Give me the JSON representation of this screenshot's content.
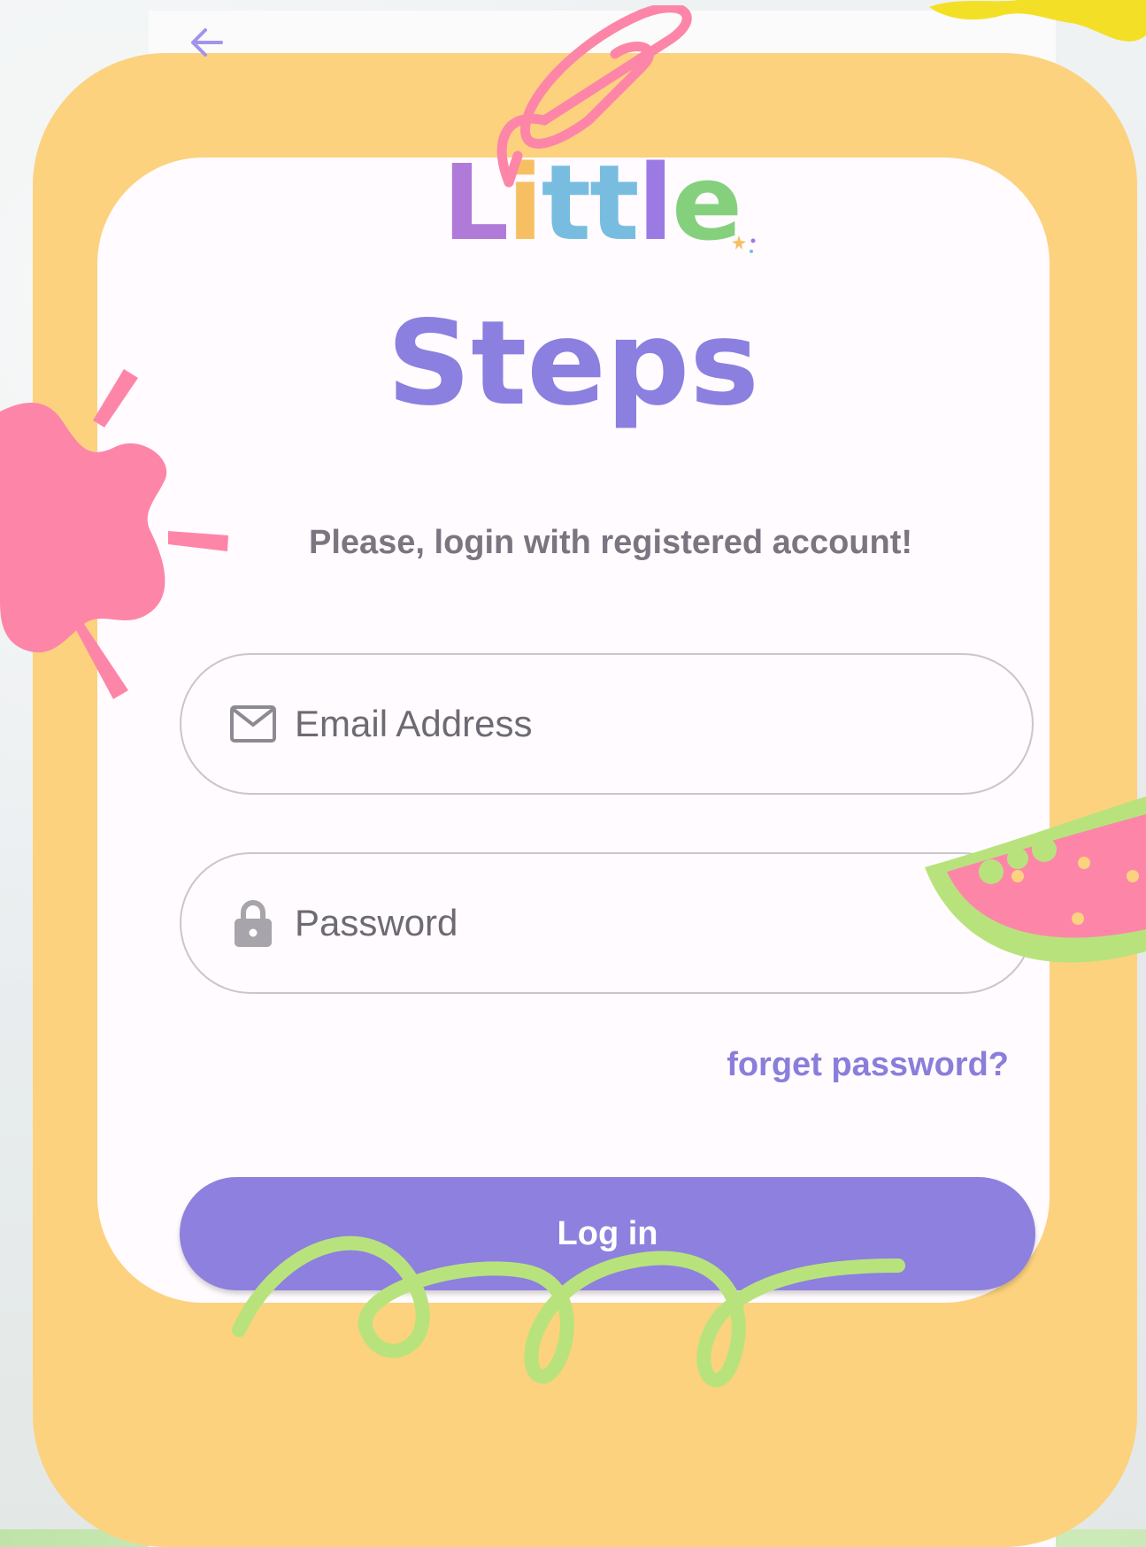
{
  "app": {
    "logo_top": [
      "L",
      "i",
      "t",
      "t",
      "l",
      "e"
    ],
    "logo_top_colors": [
      "#b07ad8",
      "#f6c062",
      "#78bde0",
      "#78bde0",
      "#9b7be3",
      "#84d07c"
    ],
    "logo_bottom": "Steps"
  },
  "login": {
    "subtitle": "Please, login with registered account!",
    "email_placeholder": "Email Address",
    "password_placeholder": "Password",
    "forgot_label": "forget password?",
    "login_label": "Log in"
  },
  "icons": {
    "back": "arrow-left-icon",
    "email": "mail-icon",
    "password": "lock-icon"
  },
  "colors": {
    "primary": "#8d80de",
    "frame": "#fcd27f",
    "accent_pink": "#fd86a8",
    "accent_green": "#b8e37c"
  }
}
